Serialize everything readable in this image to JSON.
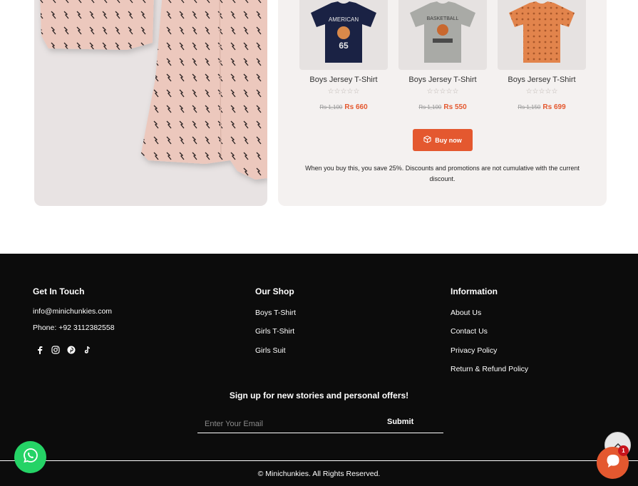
{
  "products": [
    {
      "name": "Boys Jersey T-Shirt",
      "old_price": "Rs 1,100",
      "new_price": "Rs 660",
      "shirt_color": "#1a2244",
      "print": "AMERICAN 65"
    },
    {
      "name": "Boys Jersey T-Shirt",
      "old_price": "Rs 1,100",
      "new_price": "Rs 550",
      "shirt_color": "#a9aaa6",
      "print": "BASKETBALL"
    },
    {
      "name": "Boys Jersey T-Shirt",
      "old_price": "Rs 1,150",
      "new_price": "Rs 699",
      "shirt_color": "#e2844c",
      "print": ""
    }
  ],
  "rating_stars": "☆☆☆☆☆",
  "buy_button": {
    "label": "Buy now"
  },
  "bundle_note": "When you buy this, you save 25%. Discounts and promotions are not cumulative with the current discount.",
  "footer": {
    "get_in_touch": {
      "title": "Get In Touch",
      "email": "info@minichunkies.com",
      "phone": "Phone: +92 3112382558",
      "socials": [
        "facebook-icon",
        "instagram-icon",
        "pinterest-icon",
        "tiktok-icon"
      ]
    },
    "our_shop": {
      "title": "Our Shop",
      "links": [
        "Boys T-Shirt",
        "Girls T-Shirt",
        "Girls Suit"
      ]
    },
    "information": {
      "title": "Information",
      "links": [
        "About Us",
        "Contact Us",
        "Privacy Policy",
        "Return & Refund Policy"
      ]
    },
    "signup": {
      "title": "Sign up for new stories and personal offers!",
      "placeholder": "Enter Your Email",
      "submit_label": "Submit"
    },
    "copyright": "© Minichunkies. All Rights Reserved."
  },
  "widgets": {
    "chat_badge_count": "1"
  },
  "colors": {
    "accent": "#e4582f",
    "footer_bg": "#0c0c0c",
    "whatsapp": "#25d366"
  }
}
